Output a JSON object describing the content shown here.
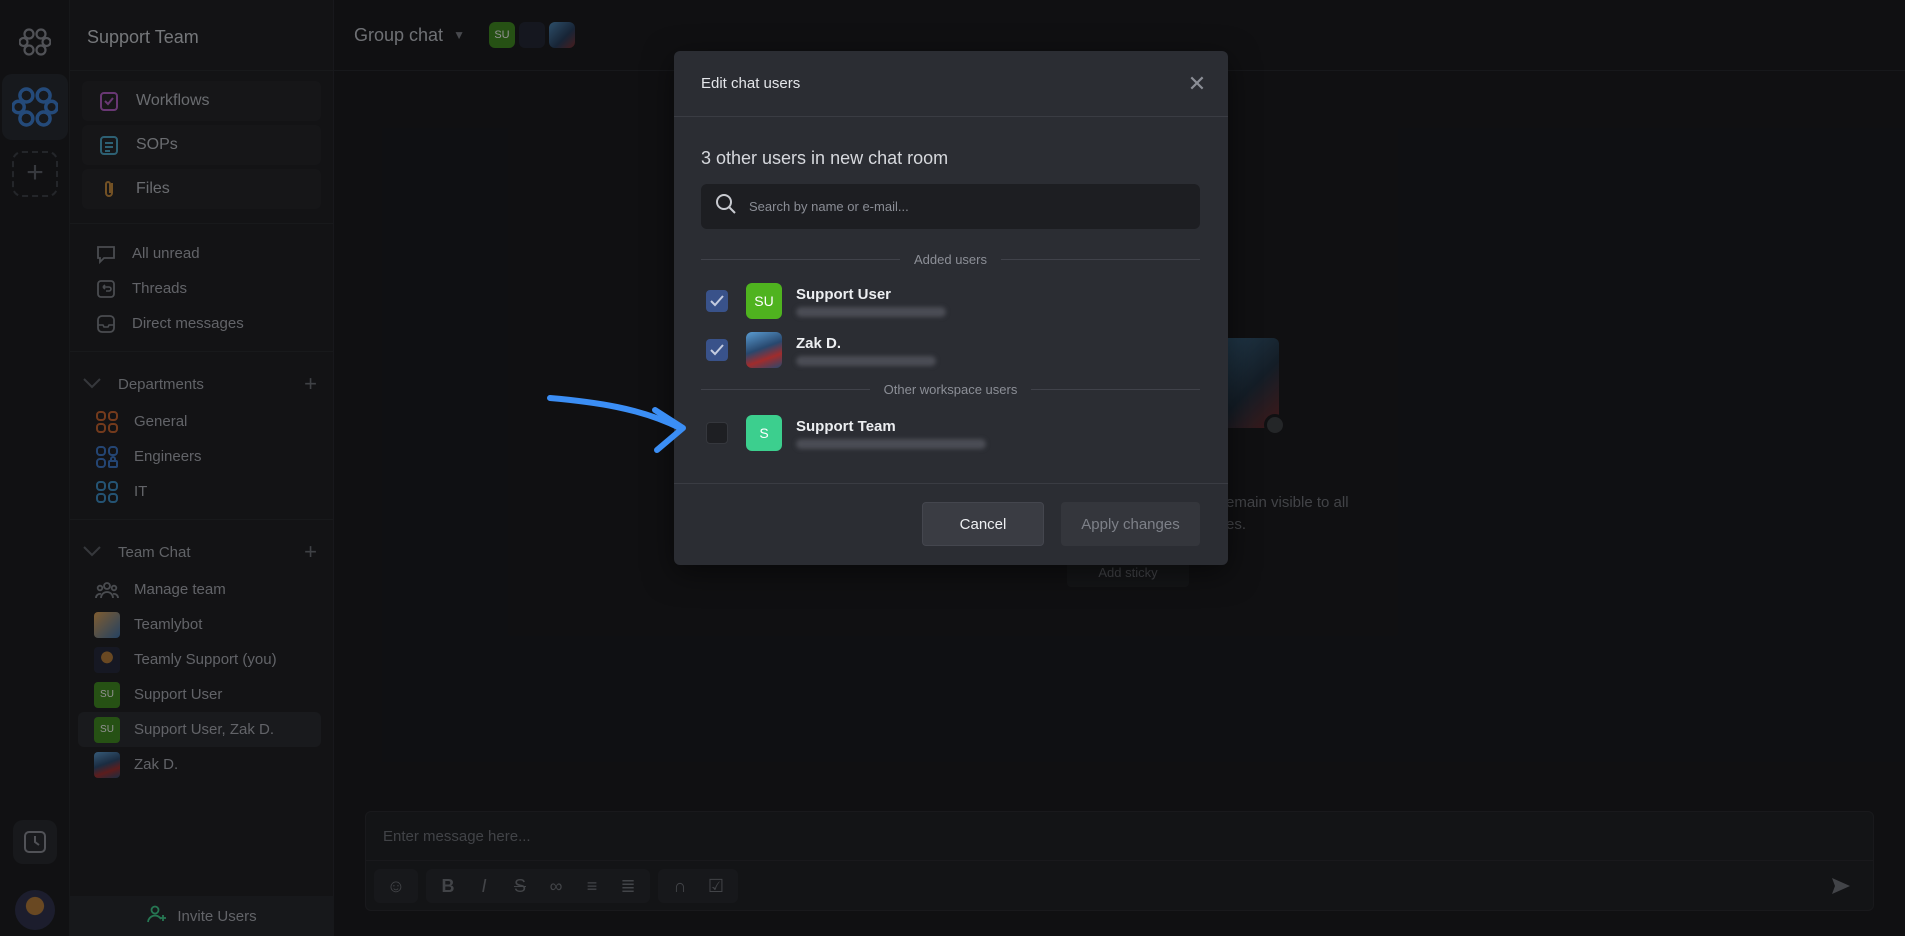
{
  "sidebar": {
    "workspace_title": "Support Team",
    "pinned": [
      {
        "label": "Workflows",
        "color": "#b55cc9"
      },
      {
        "label": "SOPs",
        "color": "#4aa6c9"
      },
      {
        "label": "Files",
        "color": "#c98a3a"
      }
    ],
    "nav": [
      {
        "label": "All unread"
      },
      {
        "label": "Threads"
      },
      {
        "label": "Direct messages"
      }
    ],
    "departments": {
      "title": "Departments",
      "items": [
        {
          "label": "General",
          "color": "#c9622a"
        },
        {
          "label": "Engineers",
          "color": "#3a76c9"
        },
        {
          "label": "IT",
          "color": "#3a8ec9"
        }
      ]
    },
    "team_chat": {
      "title": "Team Chat",
      "items": [
        {
          "label": "Manage team"
        },
        {
          "label": "Teamlybot"
        },
        {
          "label": "Teamly Support (you)"
        },
        {
          "label": "Support User",
          "avatar": "SU"
        },
        {
          "label": "Support User, Zak D.",
          "avatar": "SU"
        },
        {
          "label": "Zak D."
        }
      ]
    },
    "invite_label": "Invite Users"
  },
  "topbar": {
    "chat_name": "Group chat",
    "avatar_initials": "SU"
  },
  "background": {
    "visible_text_line1": "emain visible to all",
    "visible_text_line2": "es.",
    "sticky_label": "Add sticky"
  },
  "composer": {
    "placeholder": "Enter message here..."
  },
  "modal": {
    "title": "Edit chat users",
    "subtitle": "3 other users in new chat room",
    "search_placeholder": "Search by name or e-mail...",
    "added_label": "Added users",
    "other_label": "Other workspace users",
    "added_users": [
      {
        "name": "Support User",
        "initials": "SU",
        "checked": true
      },
      {
        "name": "Zak D.",
        "initials": "",
        "checked": true
      }
    ],
    "other_users": [
      {
        "name": "Support Team",
        "initials": "S",
        "checked": false
      }
    ],
    "cancel_label": "Cancel",
    "apply_label": "Apply changes"
  },
  "colors": {
    "accent_arrow": "#3b8ef5",
    "checkbox_on": "#39528a",
    "avatar_green": "#4fb31f",
    "avatar_teal": "#3ccf8e"
  }
}
